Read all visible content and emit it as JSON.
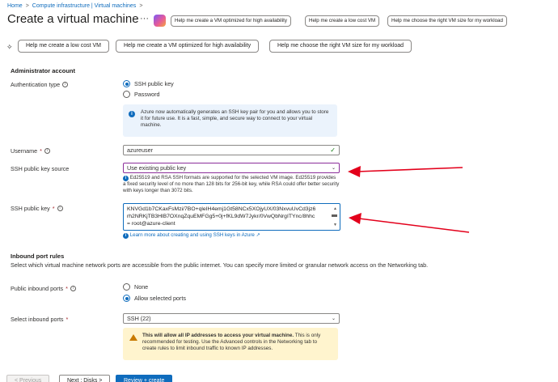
{
  "breadcrumb": {
    "items": [
      "Home",
      "Compute infrastructure | Virtual machines"
    ],
    "separator": ">"
  },
  "page": {
    "title": "Create a virtual machine",
    "more": "···"
  },
  "copilot": {
    "chips": [
      "Help me create a VM optimized for high availability",
      "Help me create a low cost VM",
      "Help me choose the right VM size for my workload"
    ]
  },
  "suggestions": [
    "Help me create a low cost VM",
    "Help me create a VM optimized for high availability",
    "Help me choose the right VM size for my workload"
  ],
  "admin": {
    "heading": "Administrator account",
    "auth_label": "Authentication type",
    "auth_options": [
      "SSH public key",
      "Password"
    ],
    "auth_selected": "SSH public key",
    "info_text": "Azure now automatically generates an SSH key pair for you and allows you to store it for future use. It is a fast, simple, and secure way to connect to your virtual machine.",
    "username_label": "Username",
    "username_value": "azureuser",
    "key_source_label": "SSH public key source",
    "key_source_value": "Use existing public key",
    "key_source_note": "Ed25519 and RSA SSH formats are supported for the selected VM image. Ed25519 provides a fixed security level of no more than 128 bits for 256-bit key, while RSA could offer better security with keys longer than 3072 bits.",
    "public_key_label": "SSH public key",
    "public_key_lines": [
      "KNVGd1b7CKaxFsMzi/7BO+qleIH4emj1Gt58NCx5XOjyUX/03NxvuUvCd3jz6",
      "rh2NRKjTB3HlB7OXnqZquEMFGg5+0j+fKL9dW7Jykr/0VwQbNrgITYnc/8hhc",
      "= root@azure-client"
    ],
    "learn_more": "Learn more about creating and using SSH keys in Azure"
  },
  "inbound": {
    "heading": "Inbound port rules",
    "description": "Select which virtual machine network ports are accessible from the public internet. You can specify more limited or granular network access on the Networking tab.",
    "public_ports_label": "Public inbound ports",
    "public_ports_options": [
      "None",
      "Allow selected ports"
    ],
    "public_ports_selected": "Allow selected ports",
    "select_ports_label": "Select inbound ports",
    "select_ports_value": "SSH (22)",
    "warning_bold": "This will allow all IP addresses to access your virtual machine.",
    "warning_text": " This is only recommended for testing.  Use the Advanced controls in the Networking tab to create rules to limit inbound traffic to known IP addresses."
  },
  "footer": {
    "previous": "< Previous",
    "next": "Next : Disks >",
    "review": "Review + create"
  },
  "colors": {
    "accent": "#0f6cbd",
    "focus_purple": "#8b2e9a",
    "arrow_red": "#e3001b",
    "warning_bg": "#fff4ce",
    "info_bg": "#ebf3fc"
  }
}
